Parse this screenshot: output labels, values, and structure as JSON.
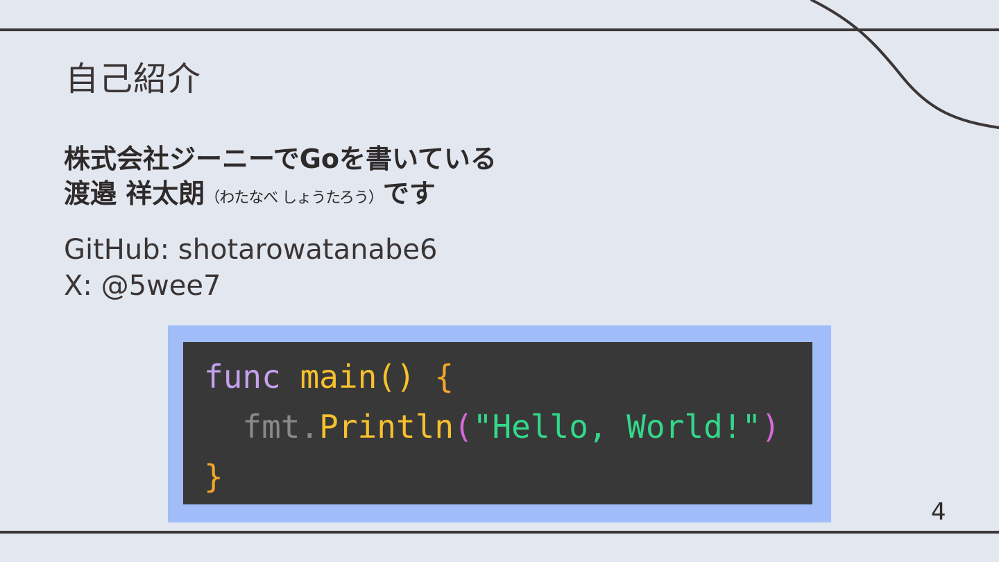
{
  "slide": {
    "title": "自己紹介",
    "intro": {
      "line1": "株式会社ジーニーでGoを書いている",
      "name": "渡邉 祥太朗",
      "reading": "（わたなべ しょうたろう）",
      "suffix": "です"
    },
    "contact": {
      "github": "GitHub: shotarowatanabe6",
      "x": "X: @5wee7"
    },
    "code": {
      "line1": {
        "keyword": "func",
        "space": " ",
        "name": "main()",
        "brace": " {"
      },
      "line2": {
        "indent": "  ",
        "pkg": "fmt.",
        "method": "Println",
        "open": "(",
        "string": "\"Hello, World!\"",
        "close": ")"
      },
      "line3": {
        "brace": "}"
      }
    },
    "page_number": "4"
  },
  "colors": {
    "background": "#e2e7f0",
    "rule": "#3d3636",
    "code_frame": "#a0bdfa",
    "code_bg": "#383838",
    "keyword": "#c5a2ec",
    "function": "#f7c02d",
    "string": "#33d88a"
  }
}
